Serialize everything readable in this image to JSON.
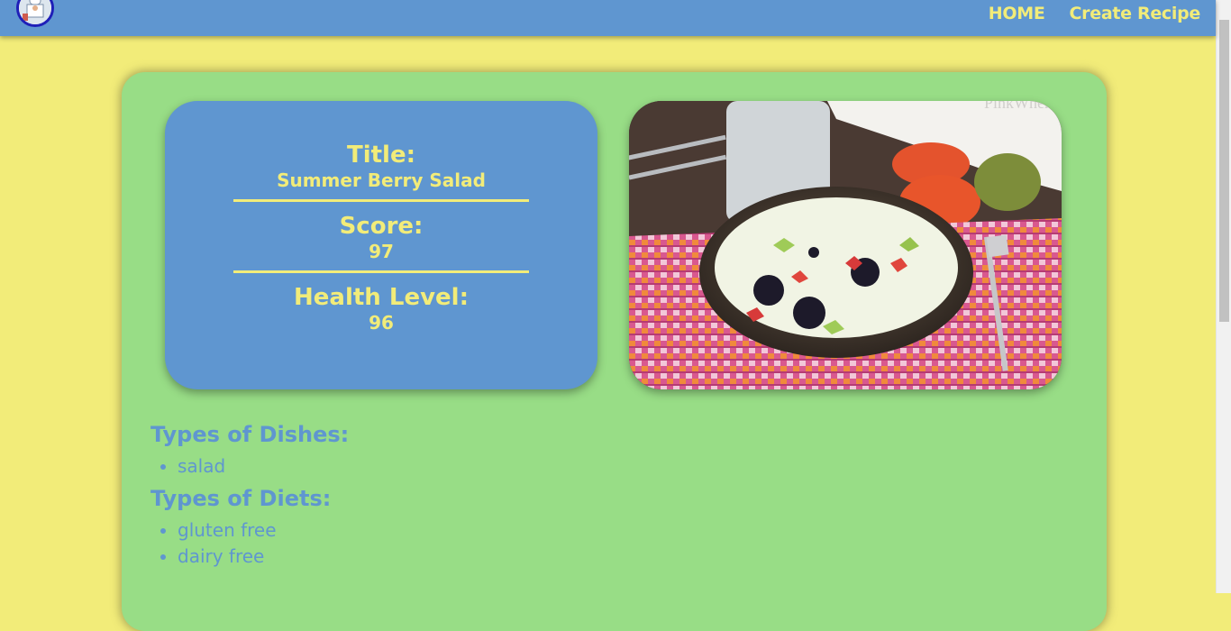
{
  "nav": {
    "logo_icon": "chef-logo-icon",
    "links": [
      "HOME",
      "Create Recipe"
    ]
  },
  "recipe": {
    "title_label": "Title:",
    "title": "Summer Berry Salad",
    "score_label": "Score:",
    "score": "97",
    "health_label": "Health Level:",
    "health": "96",
    "image_watermark": "PinkWhen"
  },
  "details": {
    "dishes_heading": "Types of Dishes:",
    "dishes": [
      "salad"
    ],
    "diets_heading": "Types of Diets:",
    "diets": [
      "gluten free",
      "dairy free"
    ]
  },
  "colors": {
    "page_bg": "#f2ec79",
    "nav_bg": "#5f96d0",
    "card_bg": "#98dd86",
    "accent_yellow": "#f2ec79",
    "text_blue": "#5f96d0"
  }
}
